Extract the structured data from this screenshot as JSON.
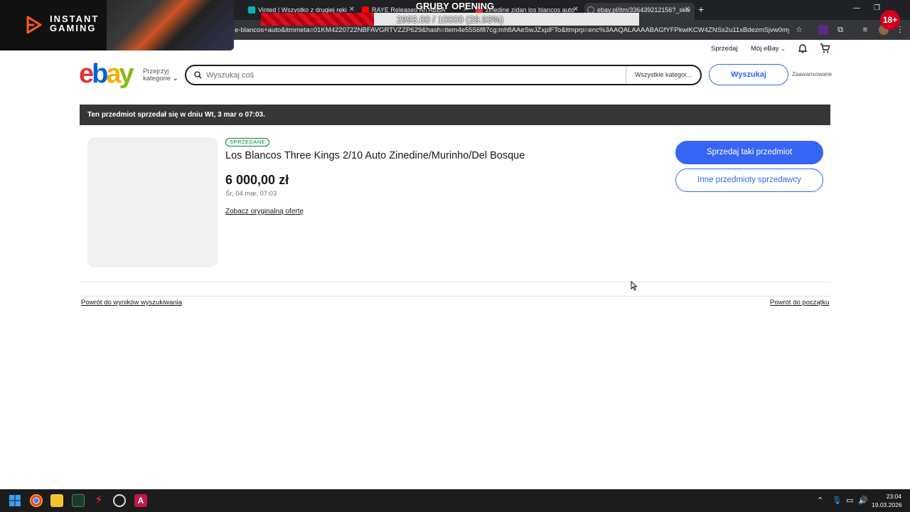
{
  "browser": {
    "tabs": [
      {
        "label": "",
        "color": "#6e6e6e"
      },
      {
        "label": "Vinted | Wszystko z drugiej ręki",
        "color": "#09b1ba"
      },
      {
        "label": "RAYE Released An ABBA",
        "color": "#ff0000"
      },
      {
        "label": "zinedine zidan los blancos auto",
        "color": "#e53238"
      },
      {
        "label": "ebay.pl/itm/336439212156?_skw",
        "color": "#9aa0a6"
      }
    ],
    "new_tab": "+",
    "url": "e-blancos+auto&itmmeta=01KM4220722NBFAVGRTVZZP629&hash=item4e5556f87cg:mh8AAeSwJZxplFTo&itmprp=enc%3AAQALAAAABAGfYFPkwiKCW4ZNSs2u11xBdezmSjvw0myPBatDh..."
  },
  "overlay": {
    "brand": "INSTANT GAMING",
    "stream_title": "GRUBY OPENING",
    "progress_text": "2993.00 / 10000 (29.93%)",
    "progress_fraction": 0.2993,
    "age_badge": "18+"
  },
  "ebay": {
    "top_links": {
      "sell": "Sprzedaj",
      "my_ebay": "Mój eBay"
    },
    "logo": {
      "e": "e",
      "b": "b",
      "a": "a",
      "y": "y"
    },
    "browse_line1": "Przejrzyj",
    "browse_line2": "kategorie",
    "search_placeholder": "Wyszukaj coś",
    "category_select": "Wszystkie kategor...",
    "search_button": "Wyszukaj",
    "advanced": "Zaawansowane",
    "sold_banner": "Ten przedmiot sprzedał się w dniu Wt, 3 mar o 07:03.",
    "item": {
      "badge": "SPRZEDANE",
      "title": "Los Blancos Three Kings 2/10 Auto Zinedine/Murinho/Del Bosque",
      "price": "6 000,00 zł",
      "date": "Śr, 04 mar, 07:03",
      "original_offer": "Zobacz oryginalną ofertę"
    },
    "buttons": {
      "sell_similar": "Sprzedaj taki przedmiot",
      "other_items": "Inne przedmioty sprzedawcy"
    },
    "footer": {
      "back_results": "Powrót do wyników wyszukiwania",
      "back_top": "Powrót do początku"
    },
    "colors": {
      "red": "#e53238",
      "blue": "#0064d2",
      "yellow": "#f5af02",
      "green": "#86b817",
      "cta": "#3665f3"
    }
  },
  "taskbar": {
    "time": "23:04",
    "date": "19.03.2026"
  }
}
